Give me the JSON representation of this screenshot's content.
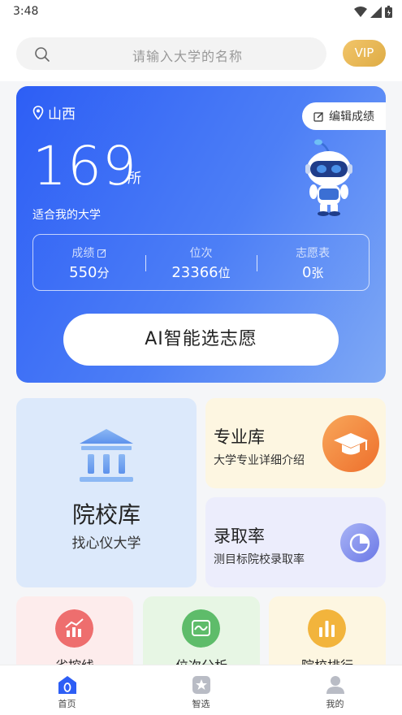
{
  "status": {
    "time": "3:48"
  },
  "search": {
    "placeholder": "请输入大学的名称"
  },
  "vip": {
    "label": "VIP"
  },
  "hero": {
    "province": "山西",
    "edit_label": "编辑成绩",
    "count": "169",
    "count_unit": "所",
    "subtitle": "适合我的大学",
    "stats": [
      {
        "label": "成绩",
        "value": "550",
        "unit": "分"
      },
      {
        "label": "位次",
        "value": "23366",
        "unit": "位"
      },
      {
        "label": "志愿表",
        "value": "0",
        "unit": "张"
      }
    ],
    "ai_button": "AI智能选志愿"
  },
  "cards": {
    "library": {
      "title": "院校库",
      "subtitle": "找心仪大学"
    },
    "major": {
      "title": "专业库",
      "subtitle": "大学专业详细介绍"
    },
    "rate": {
      "title": "录取率",
      "subtitle": "测目标院校录取率"
    },
    "bottom": [
      {
        "label": "省控线",
        "color": "#ee6e6e"
      },
      {
        "label": "位次分析",
        "color": "#5ebc6a"
      },
      {
        "label": "院校排行",
        "color": "#f2b43c"
      }
    ]
  },
  "tabs": [
    {
      "label": "首页"
    },
    {
      "label": "智选"
    },
    {
      "label": "我的"
    }
  ],
  "colors": {
    "accent": "#2d5ef5",
    "vip": "#deac45"
  }
}
